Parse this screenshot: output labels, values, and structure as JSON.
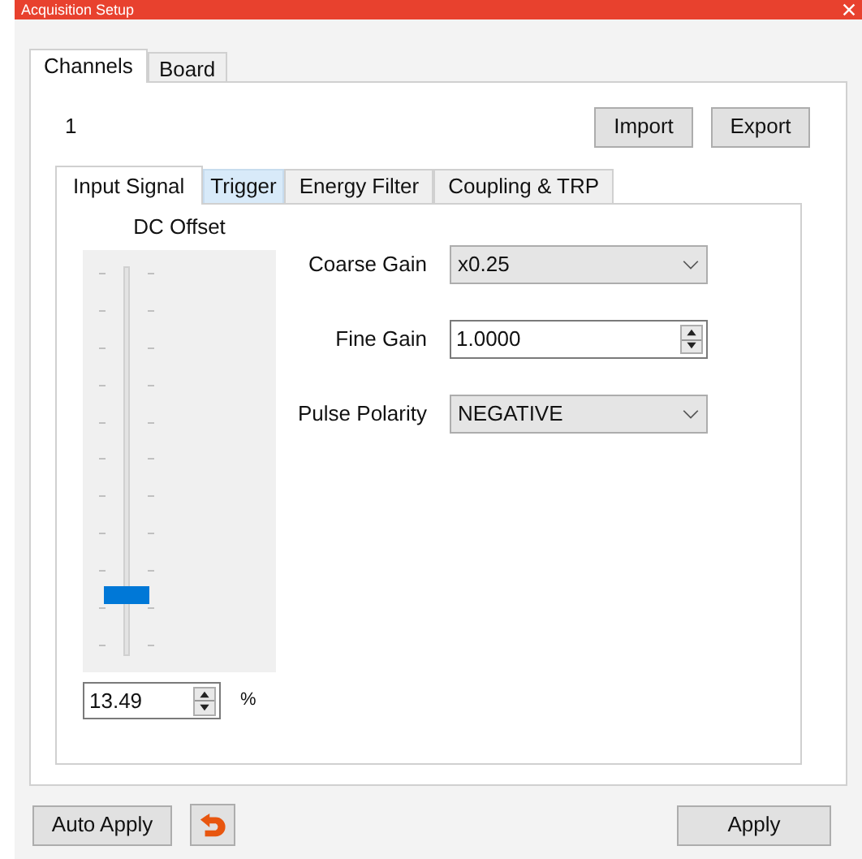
{
  "window": {
    "title": "Acquisition Setup"
  },
  "tabs": [
    {
      "label": "Channels",
      "selected": true
    },
    {
      "label": "Board",
      "selected": false
    }
  ],
  "channel": "1",
  "buttons": [
    "Import",
    "Export"
  ],
  "subtabs": [
    {
      "label": "Input Signal",
      "selected": true,
      "hover": false
    },
    {
      "label": "Trigger",
      "selected": false,
      "hover": true
    },
    {
      "label": "Energy Filter",
      "selected": false,
      "hover": false
    },
    {
      "label": "Coupling & TRP",
      "selected": false,
      "hover": false
    }
  ],
  "dc_offset": {
    "label": "DC Offset",
    "level": 0.15,
    "value": "13.49",
    "unit": "%"
  },
  "fields": [
    {
      "kind": "dropdown",
      "label": "Coarse Gain",
      "value": "x0.25"
    },
    {
      "kind": "spinner",
      "label": "Fine Gain",
      "value": "1.0000"
    },
    {
      "kind": "dropdown",
      "label": "Pulse Polarity",
      "value": "NEGATIVE"
    }
  ],
  "footer": {
    "auto_apply": "Auto Apply",
    "apply": "Apply"
  }
}
